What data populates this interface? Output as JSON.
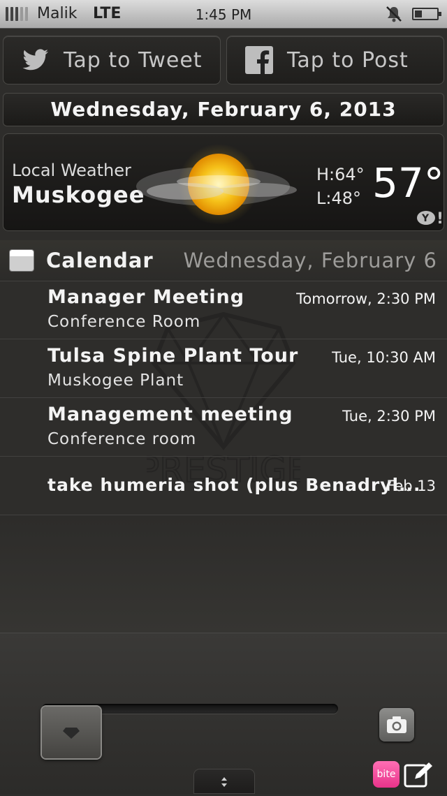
{
  "status_bar": {
    "carrier": "Malik",
    "network": "LTE",
    "time": "1:45 PM",
    "icons": [
      "signal-icon",
      "mute-icon",
      "battery-icon"
    ]
  },
  "share": {
    "tweet_label": "Tap to Tweet",
    "post_label": "Tap to Post",
    "icons": [
      "twitter-icon",
      "facebook-icon"
    ]
  },
  "date_bar": {
    "text": "Wednesday, February 6, 2013"
  },
  "weather": {
    "label": "Local Weather",
    "city": "Muskogee",
    "high": "H:64°",
    "low": "L:48°",
    "temp": "57°",
    "icons": [
      "partly-sunny-icon",
      "yahoo-icon"
    ]
  },
  "calendar": {
    "title": "Calendar",
    "date": "Wednesday, February 6",
    "events": [
      {
        "title": "Manager Meeting",
        "location": "Conference Room",
        "time": "Tomorrow, 2:30 PM"
      },
      {
        "title": "Tulsa Spine Plant Tour",
        "location": "Muskogee Plant",
        "time": "Tue, 10:30 AM"
      },
      {
        "title": "Management meeting",
        "location": "Conference room",
        "time": "Tue, 2:30 PM"
      },
      {
        "title": "take humeria shot (plus Benadryl...",
        "location": "",
        "time": "Feb 13"
      }
    ]
  },
  "watermark": {
    "text": "PRESTIGE"
  },
  "bottom": {
    "bite_label": "bite",
    "icons": [
      "unlock-slider-knob",
      "camera-icon",
      "drag-handle-icon",
      "bite-icon",
      "compose-icon"
    ]
  },
  "colors": {
    "background": "#2e2d2b",
    "status_bar": "#c4c4c4",
    "accent_pink": "#e8338a",
    "sun": "#f6c21a"
  }
}
